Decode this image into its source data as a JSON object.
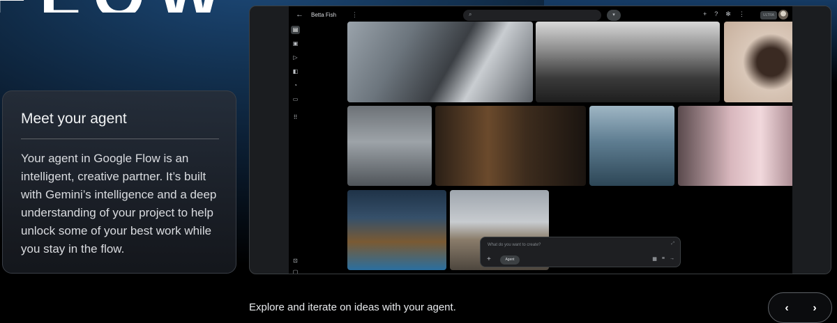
{
  "hero": {
    "fragment": "FLOW"
  },
  "agent_card": {
    "title": "Meet your agent",
    "body": "Your agent in Google Flow is an intelligent, creative partner. It’s built with Gemini’s intelligence and a deep understanding of your project to help unlock some of your best work while you stay in the flow."
  },
  "app": {
    "project_title": "Betta Fish",
    "plan_badge": "ULTRA",
    "prompt": {
      "placeholder": "What do you want to create?",
      "agent_chip": "Agent"
    },
    "icons": {
      "back": "arrow-left-icon",
      "search": "search-icon",
      "filter": "chevron-down-icon",
      "add": "plus-icon",
      "help": "help-icon",
      "settings": "settings-icon",
      "more": "more-vert-icon",
      "send": "arrow-right-icon"
    }
  },
  "caption": "Explore and iterate on ideas with your agent.",
  "nav": {
    "prev": "‹",
    "next": "›"
  },
  "colors": {
    "accent_blue": "#1d4a7a",
    "card_border": "#3a3f47",
    "frame_bg": "#1b1d20"
  }
}
